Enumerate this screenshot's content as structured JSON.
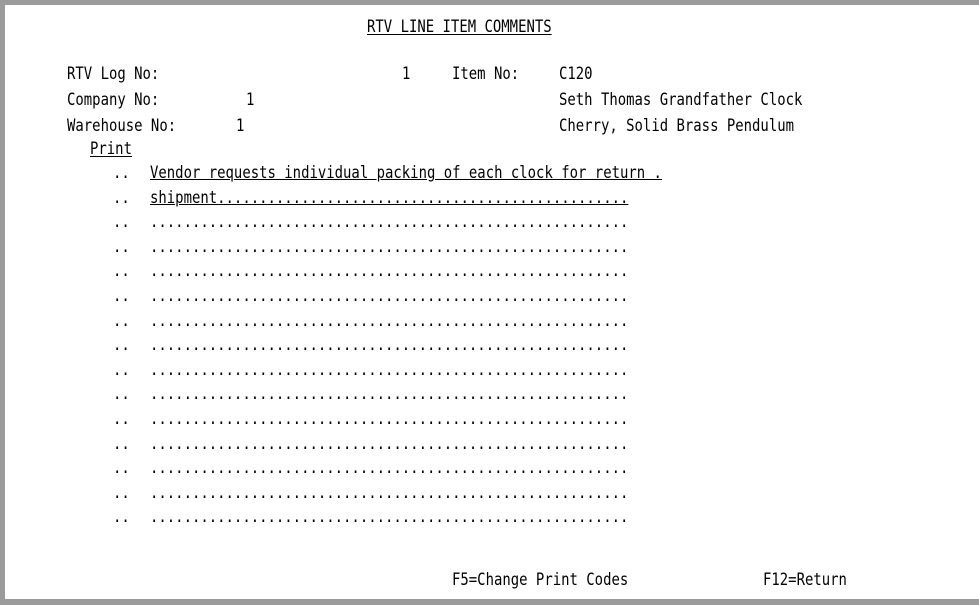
{
  "screen": {
    "title": "RTV LINE ITEM COMMENTS"
  },
  "header": {
    "rtv_log_label": "RTV Log No:",
    "rtv_log_value": "1",
    "item_label": "Item No:",
    "item_value": "C120",
    "company_label": "Company No:",
    "company_value": "1",
    "item_desc1": "Seth Thomas Grandfather Clock",
    "warehouse_label": "Warehouse No:",
    "warehouse_value": "1",
    "item_desc2": "Cherry, Solid Brass Pendulum"
  },
  "comments": {
    "print_header": "Print",
    "rows": [
      {
        "print_code": "..",
        "text": "Vendor requests individual packing of each clock for return ."
      },
      {
        "print_code": "..",
        "text": "shipment................................................."
      },
      {
        "print_code": "..",
        "text": "........................................................."
      },
      {
        "print_code": "..",
        "text": "........................................................."
      },
      {
        "print_code": "..",
        "text": "........................................................."
      },
      {
        "print_code": "..",
        "text": "........................................................."
      },
      {
        "print_code": "..",
        "text": "........................................................."
      },
      {
        "print_code": "..",
        "text": "........................................................."
      },
      {
        "print_code": "..",
        "text": "........................................................."
      },
      {
        "print_code": "..",
        "text": "........................................................."
      },
      {
        "print_code": "..",
        "text": "........................................................."
      },
      {
        "print_code": "..",
        "text": "........................................................."
      },
      {
        "print_code": "..",
        "text": "........................................................."
      },
      {
        "print_code": "..",
        "text": "........................................................."
      },
      {
        "print_code": "..",
        "text": "........................................................."
      }
    ]
  },
  "function_keys": {
    "f5": "F5=Change Print Codes",
    "f12": "F12=Return"
  }
}
